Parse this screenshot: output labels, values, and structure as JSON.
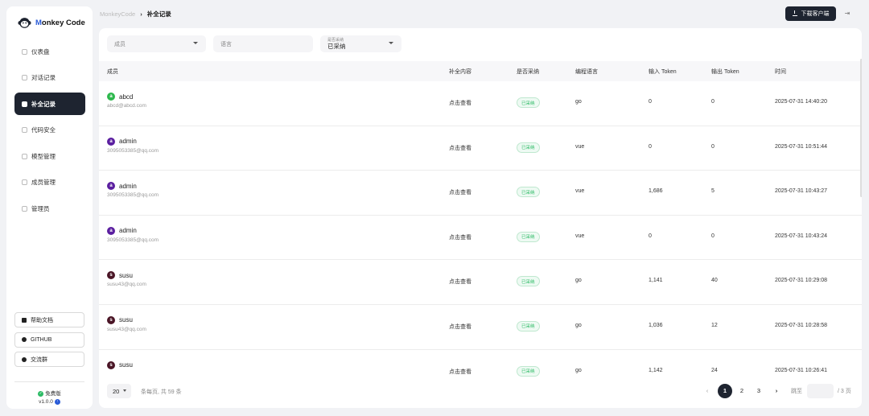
{
  "app": {
    "logo_m": "M",
    "logo_rest": "onkey Code"
  },
  "nav": [
    {
      "label": "仪表盘",
      "active": false
    },
    {
      "label": "对话记录",
      "active": false
    },
    {
      "label": "补全记录",
      "active": true
    },
    {
      "label": "代码安全",
      "active": false
    },
    {
      "label": "模型管理",
      "active": false
    },
    {
      "label": "成员管理",
      "active": false
    },
    {
      "label": "管理员",
      "active": false
    }
  ],
  "side_buttons": {
    "docs": "帮助文档",
    "github": "GITHUB",
    "community": "交流群"
  },
  "plan": {
    "label": "免费版",
    "version": "v1.0.0"
  },
  "breadcrumb": {
    "root": "MonkeyCode",
    "sep": "›",
    "current": "补全记录"
  },
  "header": {
    "download_label": "下载客户端",
    "logout_glyph": "⇥"
  },
  "filters": {
    "member_placeholder": "成员",
    "language_placeholder": "语言",
    "adopt_label": "是否采纳",
    "adopt_value": "已采纳"
  },
  "table": {
    "headers": {
      "member": "成员",
      "content": "补全内容",
      "adopted": "是否采纳",
      "language": "编程语言",
      "input_token": "输入 Token",
      "output_token": "输出 Token",
      "time": "时间"
    },
    "rows": [
      {
        "avatar": "a",
        "avatar_color": "#2db84d",
        "name": "abcd",
        "email": "abcd@abcd.com",
        "content": "点击查看",
        "adopted": "已采纳",
        "language": "go",
        "input": "0",
        "output": "0",
        "time": "2025-07-31 14:40:20"
      },
      {
        "avatar": "a",
        "avatar_color": "#5b1fa0",
        "name": "admin",
        "email": "3095053385@qq.com",
        "content": "点击查看",
        "adopted": "已采纳",
        "language": "vue",
        "input": "0",
        "output": "0",
        "time": "2025-07-31 10:51:44"
      },
      {
        "avatar": "a",
        "avatar_color": "#5b1fa0",
        "name": "admin",
        "email": "3095053385@qq.com",
        "content": "点击查看",
        "adopted": "已采纳",
        "language": "vue",
        "input": "1,686",
        "output": "5",
        "time": "2025-07-31 10:43:27"
      },
      {
        "avatar": "a",
        "avatar_color": "#5b1fa0",
        "name": "admin",
        "email": "3095053385@qq.com",
        "content": "点击查看",
        "adopted": "已采纳",
        "language": "vue",
        "input": "0",
        "output": "0",
        "time": "2025-07-31 10:43:24"
      },
      {
        "avatar": "s",
        "avatar_color": "#4a1526",
        "name": "susu",
        "email": "susu43@qq.com",
        "content": "点击查看",
        "adopted": "已采纳",
        "language": "go",
        "input": "1,141",
        "output": "40",
        "time": "2025-07-31 10:29:08"
      },
      {
        "avatar": "s",
        "avatar_color": "#4a1526",
        "name": "susu",
        "email": "susu43@qq.com",
        "content": "点击查看",
        "adopted": "已采纳",
        "language": "go",
        "input": "1,036",
        "output": "12",
        "time": "2025-07-31 10:28:58"
      },
      {
        "avatar": "s",
        "avatar_color": "#4a1526",
        "name": "susu",
        "email": "",
        "content": "点击查看",
        "adopted": "已采纳",
        "language": "go",
        "input": "1,142",
        "output": "24",
        "time": "2025-07-31 10:26:41"
      }
    ]
  },
  "pagination": {
    "page_size": "20",
    "info": "条每页, 共 59 条",
    "prev": "‹",
    "pages": [
      "1",
      "2",
      "3"
    ],
    "next": "›",
    "goto_label": "跳至",
    "total_pages": "/ 3 页"
  },
  "colors": {
    "accent": "#2a5bd7",
    "dark": "#1e2430",
    "success": "#2dbb65"
  }
}
